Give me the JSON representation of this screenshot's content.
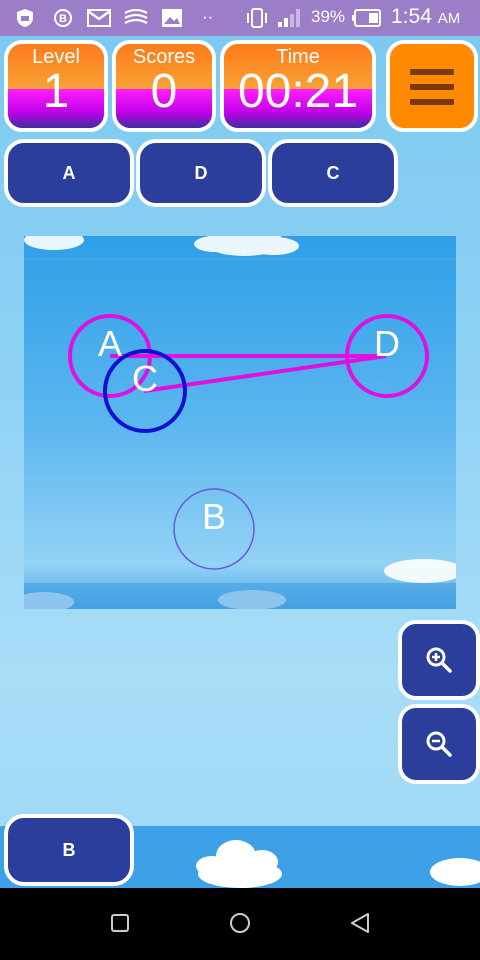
{
  "status_bar": {
    "battery_percent": "39%",
    "time": "1:54",
    "ampm": "AM",
    "dots": "··",
    "icons": [
      "shield-icon",
      "b-circle-icon",
      "gmail-icon",
      "swiftkey-icon",
      "image-icon",
      "vibrate-icon",
      "signal-icon",
      "battery-icon"
    ]
  },
  "hud": {
    "level_label": "Level",
    "level_value": "1",
    "scores_label": "Scores",
    "scores_value": "0",
    "time_label": "Time",
    "time_value": "00:21",
    "menu_icon": "hamburger-icon"
  },
  "sequence_buttons": [
    "A",
    "D",
    "C"
  ],
  "bottom_button": "B",
  "zoom": {
    "in_icon": "zoom-in-icon",
    "out_icon": "zoom-out-icon"
  },
  "board": {
    "nodes": [
      {
        "label": "A",
        "state": "connected",
        "color": "#e010e0"
      },
      {
        "label": "C",
        "state": "active",
        "color": "#1010d0"
      },
      {
        "label": "D",
        "state": "connected",
        "color": "#e010e0"
      },
      {
        "label": "B",
        "state": "pending",
        "color": "#6a5ad8"
      }
    ],
    "links": [
      [
        "A",
        "D"
      ],
      [
        "D",
        "C"
      ]
    ],
    "link_color": "#e010e0"
  },
  "nav_bar": {
    "icons": [
      "recents-icon",
      "home-icon",
      "back-icon"
    ]
  }
}
